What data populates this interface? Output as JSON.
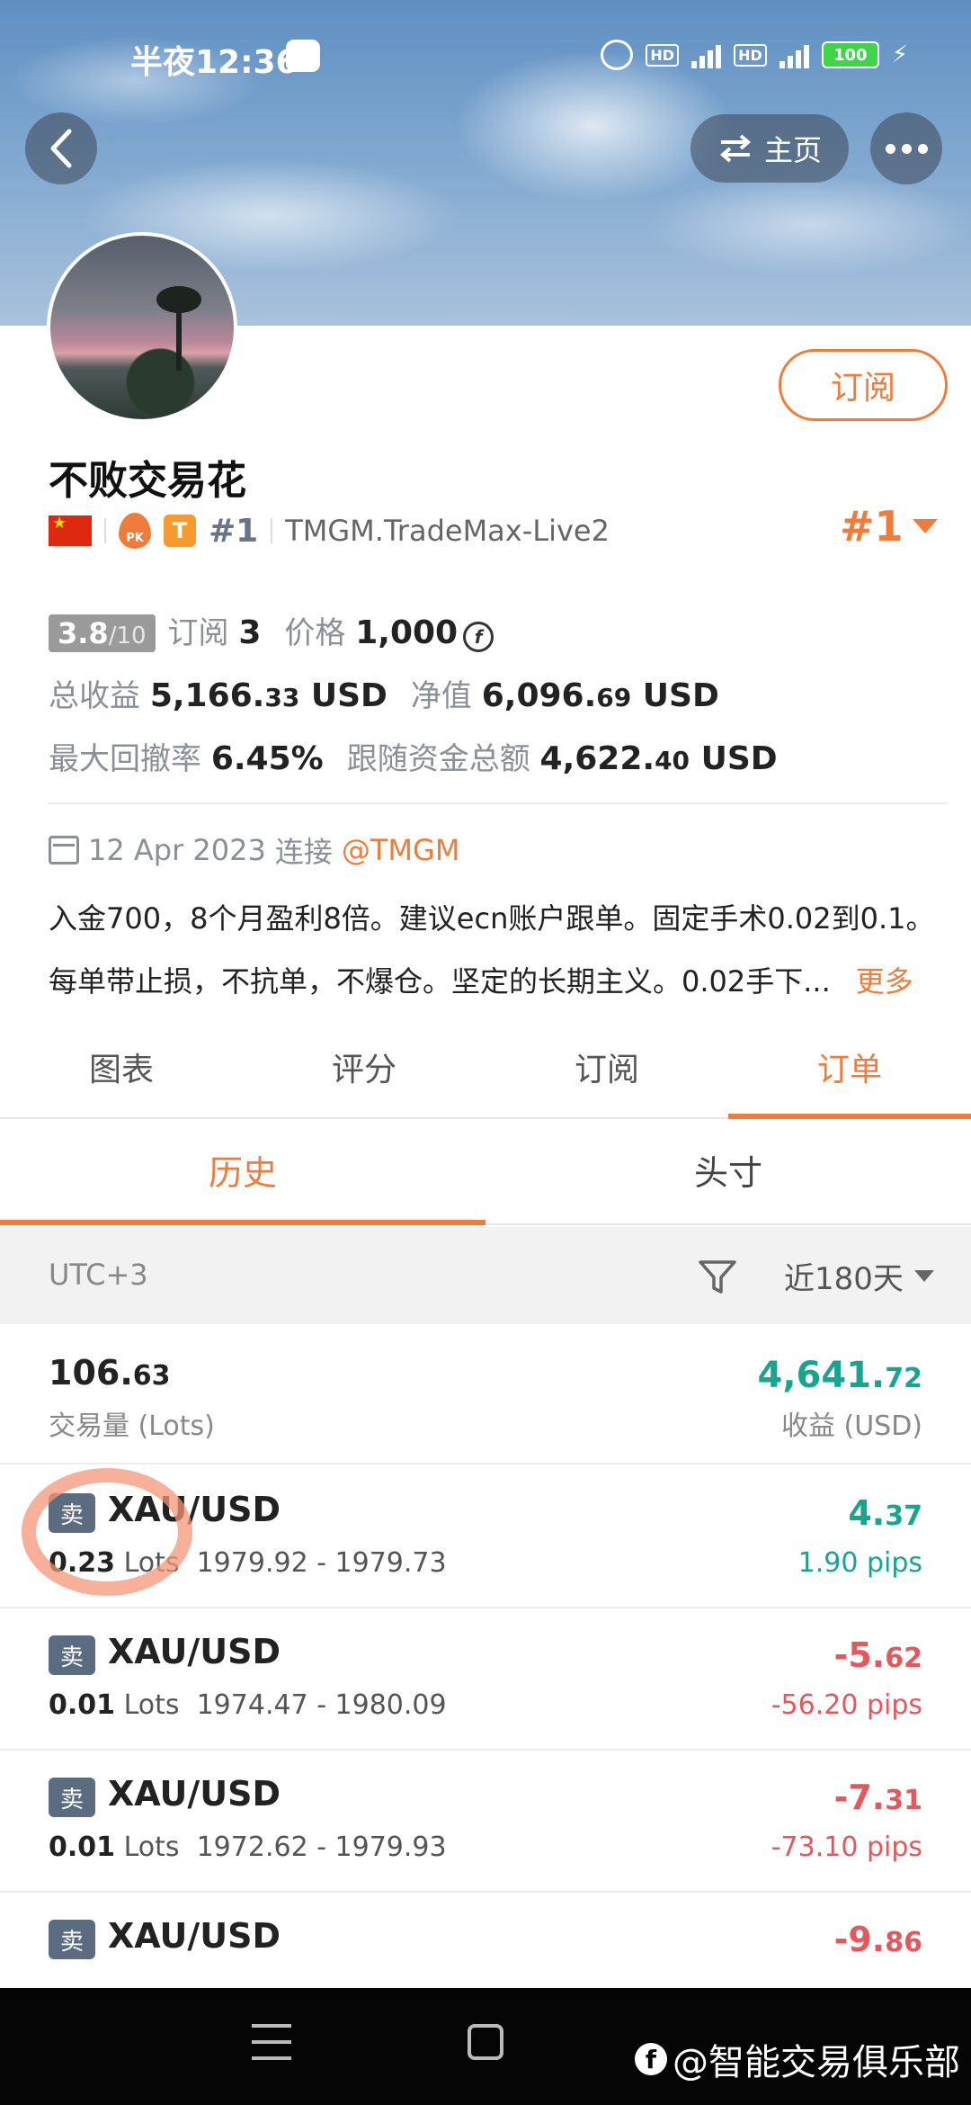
{
  "status_bar": {
    "time": "半夜12:36",
    "battery": "100",
    "net_1": "5G",
    "net_2": "4G",
    "hd": "HD"
  },
  "header": {
    "home_label": "主页",
    "subscribe_label": "订阅"
  },
  "profile": {
    "name": "不败交易花",
    "pk_label": "PK",
    "t_label": "T",
    "rank": "#1",
    "broker": "TMGM.TradeMax-Live2",
    "rank_right": "#1"
  },
  "stats": {
    "rating": "3.8",
    "rating_max": "/10",
    "subscribe_label": "订阅",
    "subscribe_count": "3",
    "price_label": "价格",
    "price_value": "1,000",
    "total_profit_label": "总收益",
    "total_profit_main": "5,166.",
    "total_profit_dec": "33",
    "total_profit_unit": "USD",
    "net_value_label": "净值",
    "net_value_main": "6,096.",
    "net_value_dec": "69",
    "net_value_unit": "USD",
    "max_drawdown_label": "最大回撤率",
    "max_drawdown_value": "6.45%",
    "follow_label": "跟随资金总额",
    "follow_main": "4,622.",
    "follow_dec": "40",
    "follow_unit": "USD"
  },
  "connect": {
    "date": "12 Apr 2023",
    "label": "连接",
    "broker_link": "@TMGM"
  },
  "description": {
    "line1": "入金700，8个月盈利8倍。建议ecn账户跟单。固定手术0.02到0.1。",
    "line2": "每单带止损，不抗单，不爆仓。坚定的长期主义。0.02手下...",
    "more_label": "更多"
  },
  "main_tabs": [
    "图表",
    "评分",
    "订阅",
    "订单"
  ],
  "main_tab_active": 3,
  "sub_tabs": [
    "历史",
    "头寸"
  ],
  "filter": {
    "timezone": "UTC+3",
    "range": "近180天"
  },
  "summary": {
    "lots_main": "106.",
    "lots_dec": "63",
    "lots_label": "交易量 (Lots)",
    "profit_main": "4,641.",
    "profit_dec": "72",
    "profit_label": "收益 (USD)"
  },
  "orders": [
    {
      "side": "卖",
      "symbol": "XAU/USD",
      "lots": "0.23",
      "lots_unit": "Lots",
      "prices": "1979.92 - 1979.73",
      "profit_main": "4.",
      "profit_dec": "37",
      "pips": "1.90 pips",
      "sign": "pos"
    },
    {
      "side": "卖",
      "symbol": "XAU/USD",
      "lots": "0.01",
      "lots_unit": "Lots",
      "prices": "1974.47 - 1980.09",
      "profit_main": "-5.",
      "profit_dec": "62",
      "pips": "-56.20 pips",
      "sign": "neg"
    },
    {
      "side": "卖",
      "symbol": "XAU/USD",
      "lots": "0.01",
      "lots_unit": "Lots",
      "prices": "1972.62 - 1979.93",
      "profit_main": "-7.",
      "profit_dec": "31",
      "pips": "-73.10 pips",
      "sign": "neg"
    },
    {
      "side": "卖",
      "symbol": "XAU/USD",
      "lots": "",
      "lots_unit": "",
      "prices": "",
      "profit_main": "-9.",
      "profit_dec": "86",
      "pips": "",
      "sign": "neg"
    }
  ],
  "watermark": "@智能交易俱乐部"
}
